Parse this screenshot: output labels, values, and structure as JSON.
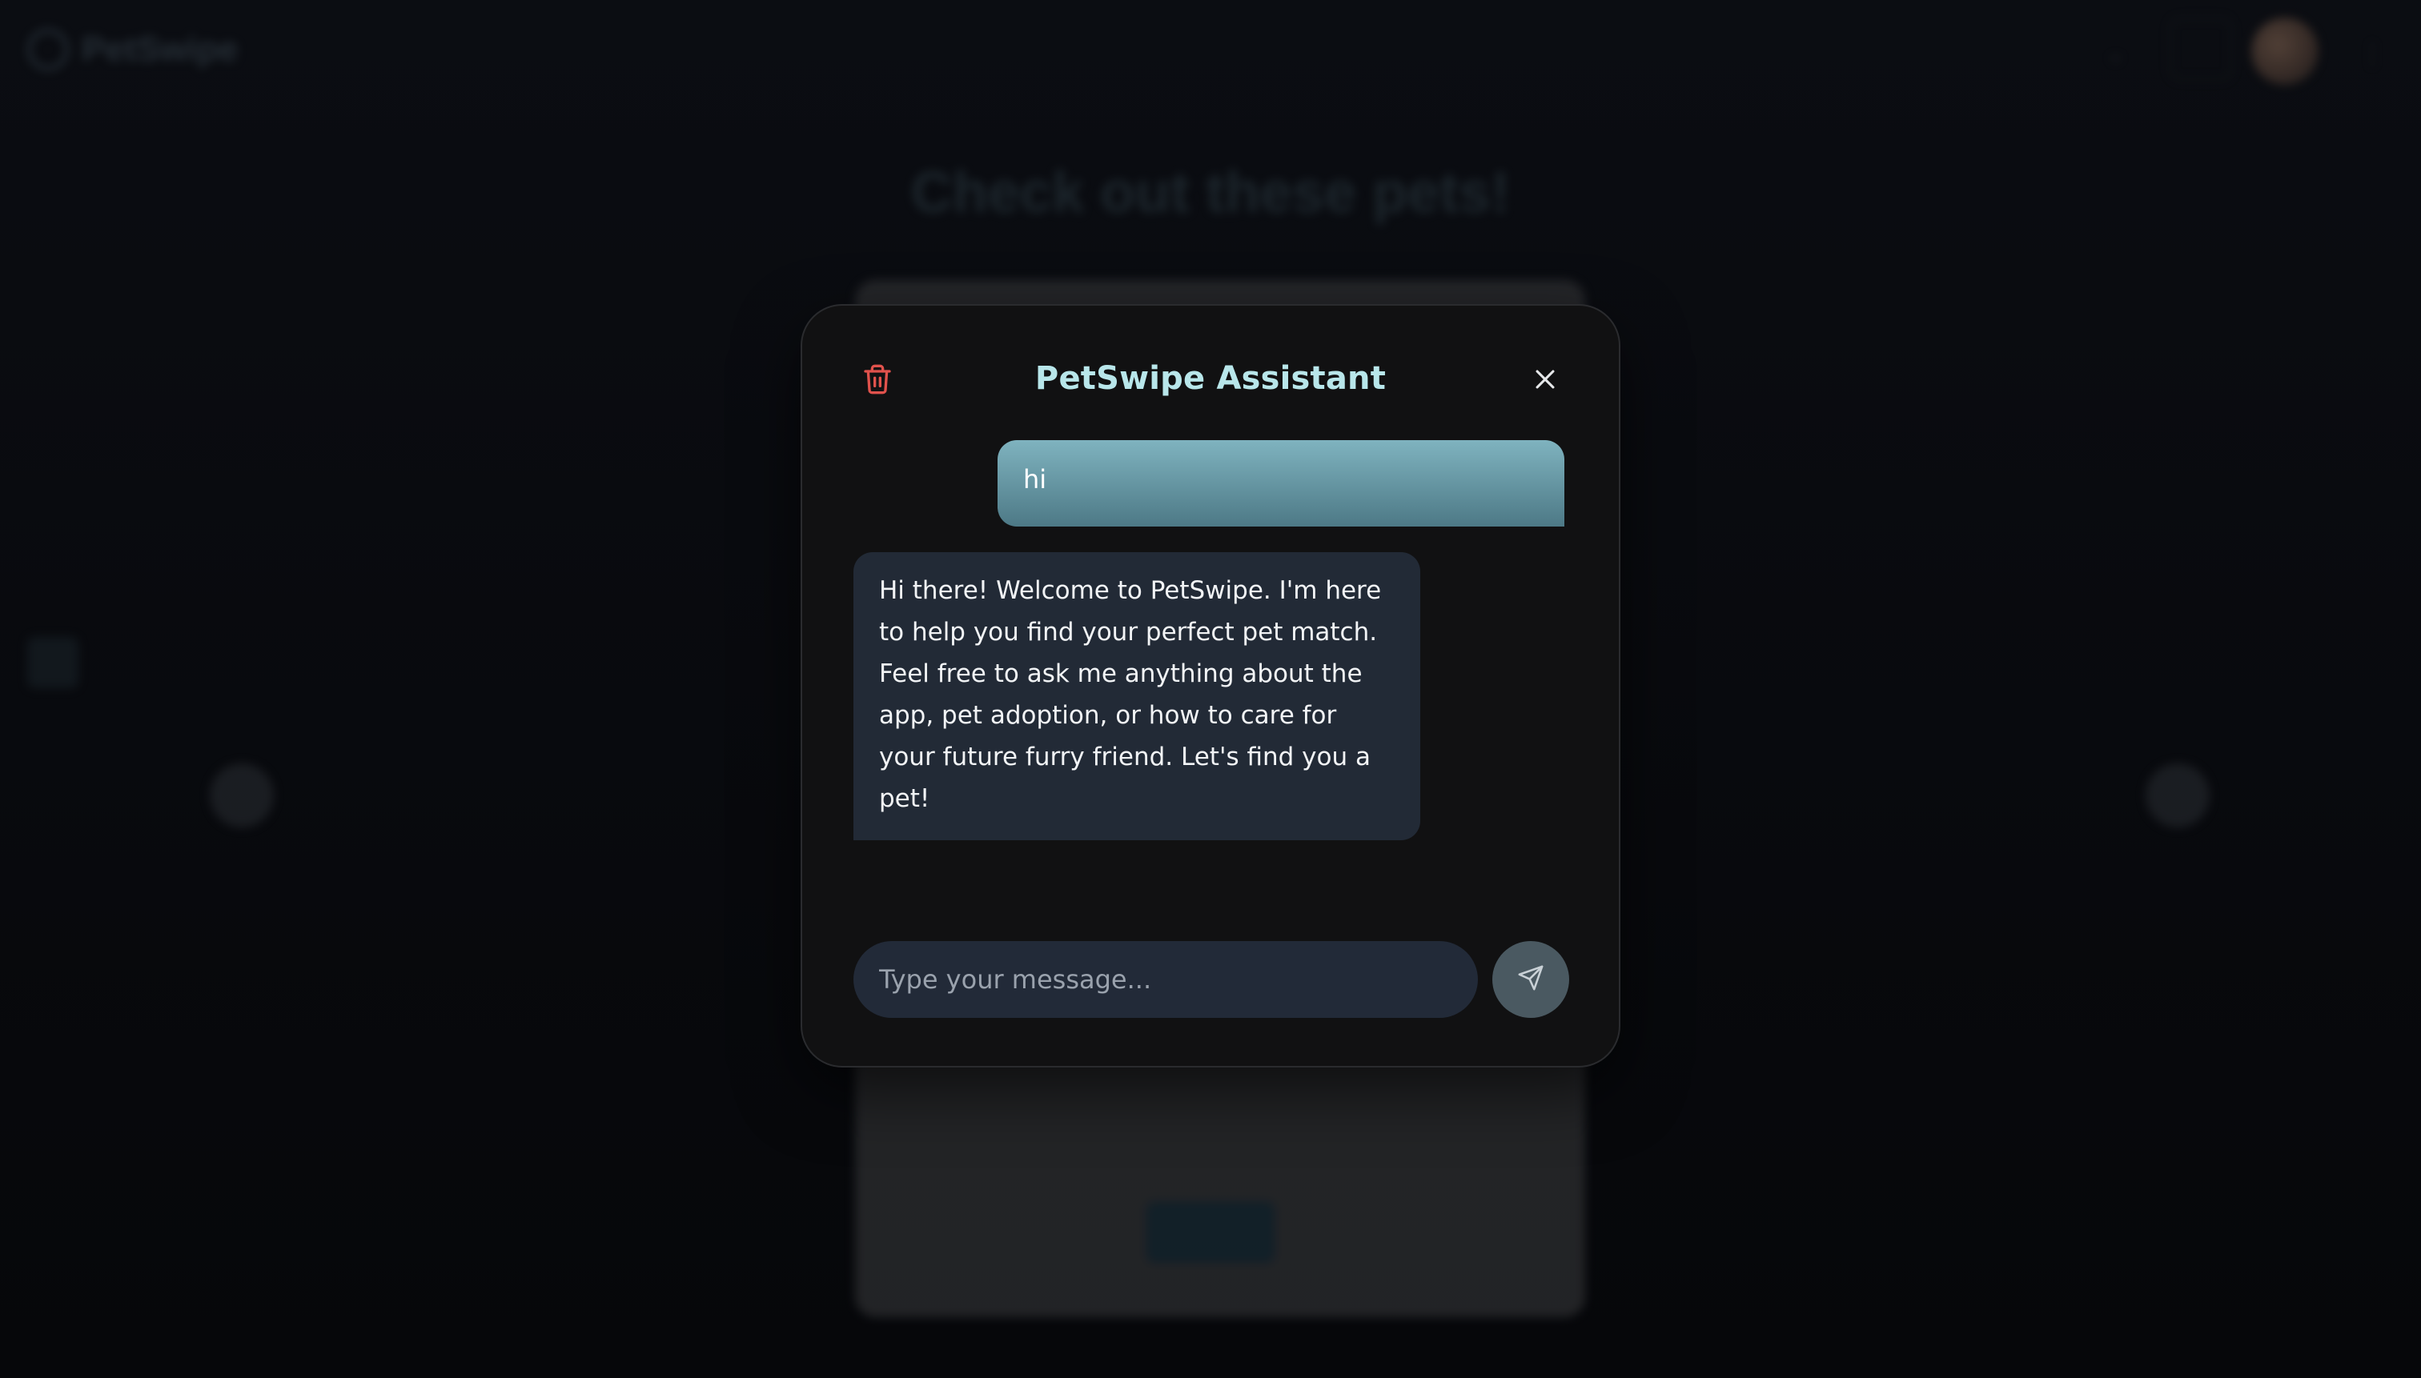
{
  "app": {
    "name": "PetSwipe"
  },
  "background": {
    "heading": "Check out these pets!"
  },
  "modal": {
    "title": "PetSwipe Assistant",
    "messages": [
      {
        "role": "user",
        "text": "hi"
      },
      {
        "role": "assistant",
        "text": "Hi there! Welcome to PetSwipe. I'm here to help you find your perfect pet match. Feel free to ask me anything about the app, pet adoption, or how to care for your future furry friend. Let's find you a pet!"
      }
    ],
    "input": {
      "value": "",
      "placeholder": "Type your message..."
    }
  },
  "icons": {
    "trash": "trash-icon",
    "close": "close-icon",
    "send": "send-icon"
  },
  "colors": {
    "title": "#b8e6ea",
    "trash": "#e0524c",
    "user_bubble_top": "#7fb3bf",
    "user_bubble_bottom": "#4d7986",
    "assistant_bubble": "#222a36",
    "modal_bg": "#111112"
  }
}
